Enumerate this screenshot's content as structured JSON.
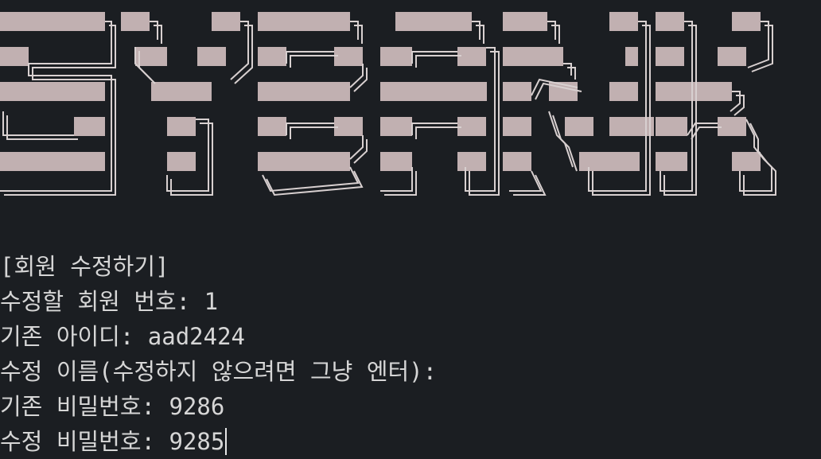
{
  "theme": {
    "background": "#1b1e22",
    "banner_block_color": "#c1b0b1",
    "banner_outline_color": "#d8d0d0",
    "text_color": "#d6d6d6"
  },
  "banner": {
    "style": "ascii-art-block-letters",
    "glyph_count": 8
  },
  "terminal": {
    "lines": [
      "[회원 수정하기]",
      "수정할 회원 번호: 1",
      "기존 아이디: aad2424",
      "수정 이름(수정하지 않으려면 그냥 엔터):",
      "기존 비밀번호: 9286",
      "수정 비밀번호: 9285"
    ],
    "active_line_index": 5
  }
}
